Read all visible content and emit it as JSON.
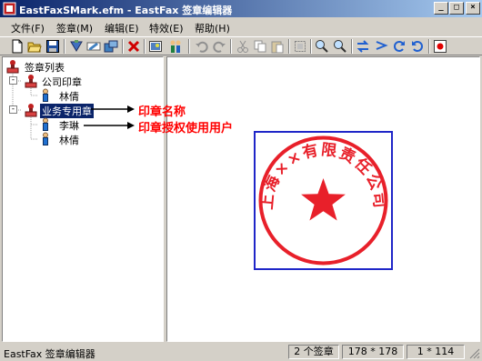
{
  "window": {
    "title": "EastFaxSMark.efm - EastFax 签章编辑器",
    "controls": {
      "minimize": "_",
      "maximize": "□",
      "close": "×"
    }
  },
  "menu": [
    {
      "label": "文件(F)"
    },
    {
      "label": "签章(M)"
    },
    {
      "label": "编辑(E)"
    },
    {
      "label": "特效(E)"
    },
    {
      "label": "帮助(H)"
    }
  ],
  "toolbar_icons": [
    "new-file-icon",
    "open-folder-icon",
    "save-icon",
    "stamp-props-icon",
    "edit-text-icon",
    "export-icon",
    "delete-icon",
    "image-icon",
    "users-icon",
    "undo-icon",
    "redo-icon",
    "cut-icon",
    "copy-icon",
    "paste-icon",
    "select-frame-icon",
    "zoom-in-icon",
    "zoom-out-icon",
    "flip-horizontal-icon",
    "flip-vertical-icon",
    "rotate-left-icon",
    "rotate-right-icon",
    "record-icon"
  ],
  "tree": {
    "root": "签章列表",
    "nodes": [
      {
        "label": "公司印章",
        "users": [
          "林倩"
        ]
      },
      {
        "label": "业务专用章",
        "users": [
          "李琳",
          "林倩"
        ]
      }
    ]
  },
  "annotations": {
    "seal_name": "印章名称",
    "authorized_user": "印章授权使用用户"
  },
  "seal": {
    "text": "上海××有限责任公司",
    "color": "#e8202a",
    "frame_color": "#1f26c8"
  },
  "status": {
    "main": "EastFax 签章编辑器",
    "count": "2 个签章",
    "size": "178 * 178",
    "scale": "1 * 114"
  },
  "colors": {
    "selection": "#0a246a",
    "title_gradient_start": "#0a246a",
    "annotation": "#ff0000"
  }
}
